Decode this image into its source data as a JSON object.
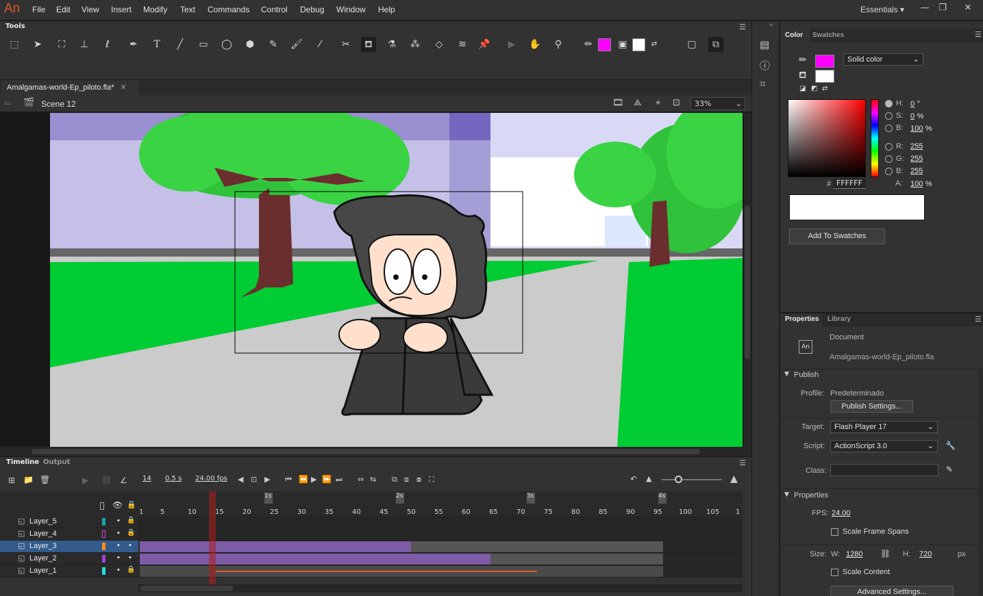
{
  "app": {
    "logo": "An",
    "menus": [
      "File",
      "Edit",
      "View",
      "Insert",
      "Modify",
      "Text",
      "Commands",
      "Control",
      "Debug",
      "Window",
      "Help"
    ],
    "workspace": "Essentials"
  },
  "tools": {
    "header": "Tools"
  },
  "document": {
    "tab": "Amalgamas-world-Ep_piloto.fla*",
    "scene": "Scene 12",
    "zoom": "33%"
  },
  "timeline": {
    "tabs": [
      "Timeline",
      "Output"
    ],
    "frame": "14",
    "time": "0.5 s",
    "fps": "24.00 fps",
    "seconds": [
      "1s",
      "2s",
      "3s",
      "4s"
    ],
    "ticks": [
      "1",
      "5",
      "10",
      "15",
      "20",
      "25",
      "30",
      "35",
      "40",
      "45",
      "50",
      "55",
      "60",
      "65",
      "70",
      "75",
      "80",
      "85",
      "90",
      "95",
      "100",
      "105",
      "1"
    ],
    "layers": [
      {
        "name": "Layer_5",
        "color": "#1ea0a0"
      },
      {
        "name": "Layer_4",
        "color": "#e040e0"
      },
      {
        "name": "Layer_3",
        "color": "#ff8c1a"
      },
      {
        "name": "Layer_2",
        "color": "#a040e0"
      },
      {
        "name": "Layer_1",
        "color": "#20e0e0"
      }
    ]
  },
  "color": {
    "tabs": [
      "Color",
      "Swatches"
    ],
    "type": "Solid color",
    "stroke": "#ff00ff",
    "fill": "#ffffff",
    "h": "0",
    "h_unit": "°",
    "s": "0",
    "s_unit": "%",
    "b": "100",
    "b_unit": "%",
    "r": "255",
    "g": "255",
    "bl": "255",
    "a": "100",
    "a_unit": "%",
    "hex_label": "#",
    "hex": "FFFFFF",
    "add": "Add To Swatches",
    "labels": {
      "h": "H:",
      "s": "S:",
      "b": "B:",
      "r": "R:",
      "g": "G:",
      "bl": "B:",
      "a": "A:"
    }
  },
  "properties": {
    "tabs": [
      "Properties",
      "Library"
    ],
    "doc_label": "Document",
    "doc_icon": "An",
    "doc_name": "Amalgamas-world-Ep_piloto.fla",
    "publish": "Publish",
    "profile_label": "Profile:",
    "profile": "Predeterminado",
    "publish_settings": "Publish Settings...",
    "target_label": "Target:",
    "target": "Flash Player 17",
    "script_label": "Script:",
    "script": "ActionScript 3.0",
    "class_label": "Class:",
    "props": "Properties",
    "fps_label": "FPS:",
    "fps": "24.00",
    "scale_frame": "Scale Frame Spans",
    "size_label": "Size:",
    "w_label": "W:",
    "w": "1280",
    "h_label": "H:",
    "h": "720",
    "px": "px",
    "scale_content": "Scale Content",
    "advanced": "Advanced Settings..."
  }
}
